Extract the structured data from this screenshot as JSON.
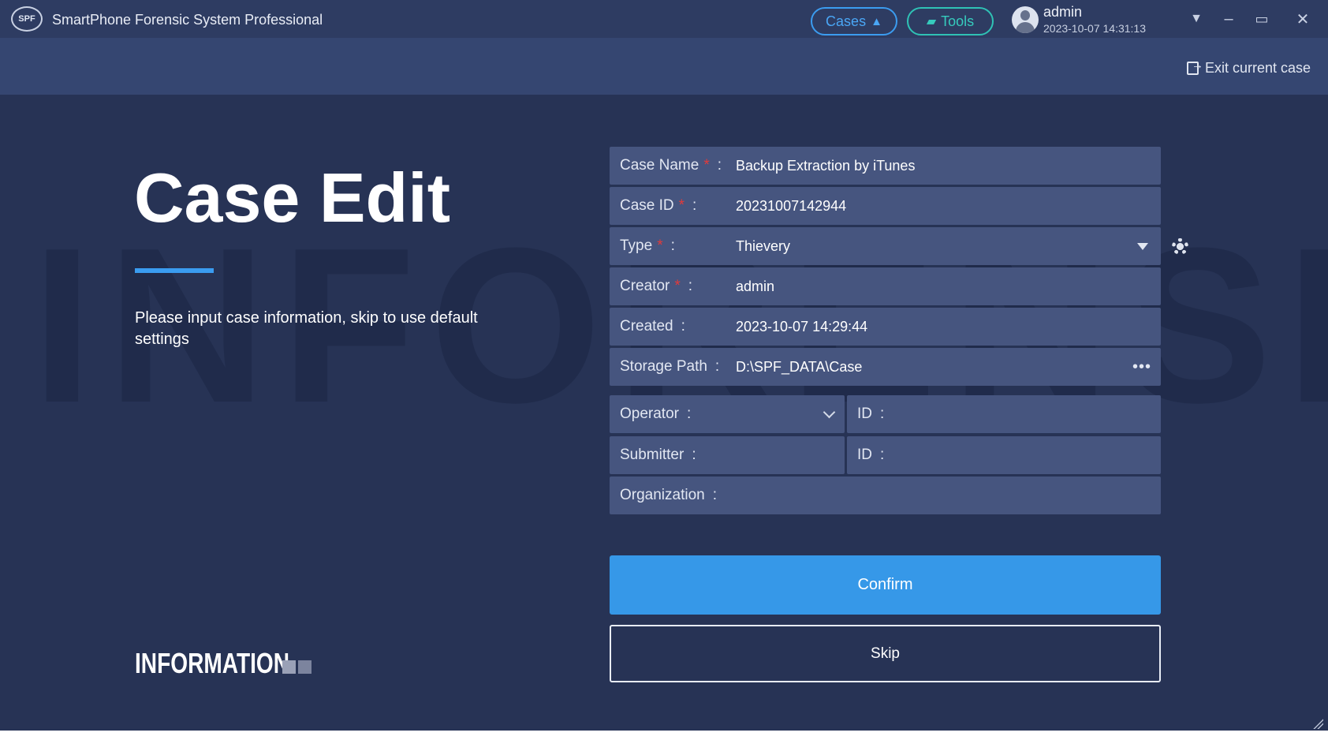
{
  "app": {
    "logo_text": "SPF",
    "title": "SmartPhone Forensic System Professional"
  },
  "header": {
    "cases_label": "Cases",
    "tools_label": "Tools",
    "user_name": "admin",
    "timestamp": "2023-10-07 14:31:13",
    "exit_label": "Exit current case"
  },
  "hero": {
    "heading": "Case Edit",
    "subtitle": "Please input case information, skip to use default settings",
    "watermark": "INFORENSICATION",
    "info_label": "INFORMATION"
  },
  "form": {
    "case_name": {
      "label": "Case Name",
      "value": "Backup Extraction by iTunes"
    },
    "case_id": {
      "label": "Case ID",
      "value": "20231007142944"
    },
    "type": {
      "label": "Type",
      "value": "Thievery"
    },
    "creator": {
      "label": "Creator",
      "value": "admin"
    },
    "created": {
      "label": "Created",
      "value": "2023-10-07 14:29:44"
    },
    "storage_path": {
      "label": "Storage Path",
      "value": "D:\\SPF_DATA\\Case"
    },
    "operator": {
      "label": "Operator",
      "value": ""
    },
    "operator_id": {
      "label": "ID",
      "value": ""
    },
    "submitter": {
      "label": "Submitter",
      "value": ""
    },
    "submitter_id": {
      "label": "ID",
      "value": ""
    },
    "organization": {
      "label": "Organization",
      "value": ""
    },
    "required_mark": "*",
    "colon": ":"
  },
  "actions": {
    "confirm_label": "Confirm",
    "skip_label": "Skip"
  },
  "colors": {
    "accent": "#3698e8",
    "tools_accent": "#2fc2b5",
    "required": "#e23a3a"
  }
}
